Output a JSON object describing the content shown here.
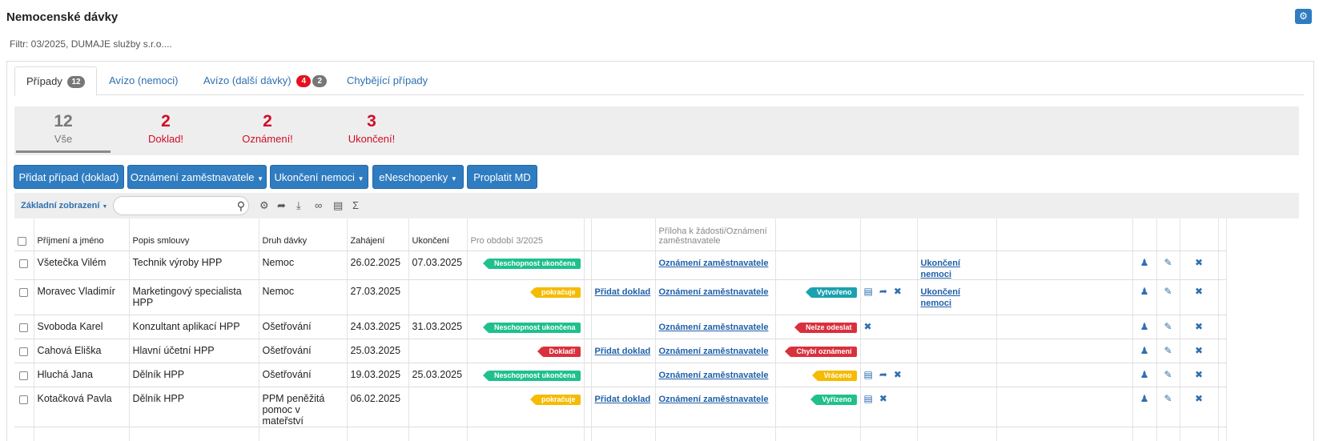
{
  "page": {
    "title": "Nemocenské dávky",
    "filter": "Filtr: 03/2025, DUMAJE služby s.r.o...."
  },
  "header": {
    "settings_icon": "gear-icon"
  },
  "tabs": [
    {
      "label": "Případy",
      "count": "12"
    },
    {
      "label": "Avízo (nemoci)"
    },
    {
      "label": "Avízo (další dávky)",
      "count_red": "4",
      "count": "2"
    },
    {
      "label": "Chybějící případy"
    }
  ],
  "summary": [
    {
      "num": "12",
      "label": "Vše"
    },
    {
      "num": "2",
      "label": "Doklad!"
    },
    {
      "num": "2",
      "label": "Oznámení!"
    },
    {
      "num": "3",
      "label": "Ukončení!"
    }
  ],
  "actions": {
    "add_case": "Přidat případ (doklad)",
    "employer_notice": "Oznámení zaměstnavatele",
    "end_illness": "Ukončení nemoci",
    "eneschopenky": "eNeschopenky",
    "pay_md": "Proplatit MD"
  },
  "toolbar": {
    "view": "Základní zobrazení",
    "search_placeholder": ""
  },
  "columns": {
    "name": "Příjmení a jméno",
    "contract": "Popis smlouvy",
    "type": "Druh dávky",
    "start": "Zahájení",
    "end": "Ukončení",
    "period": "Pro období 3/2025",
    "attachment": "Příloha k žádosti/Oznámení zaměstnavatele"
  },
  "links": {
    "add_doc": "Přidat doklad",
    "employer_notice": "Oznámení zaměstnavatele",
    "end_illness": "Ukončení nemoci"
  },
  "rows": [
    {
      "name": "Všetečka Vilém",
      "contract": "Technik výroby HPP",
      "type": "Nemoc",
      "start": "26.02.2025",
      "end": "07.03.2025",
      "period_badge": "Neschopnost ukončena",
      "status_badge": ""
    },
    {
      "name": "Moravec Vladimír",
      "contract": "Marketingový specialista HPP",
      "type": "Nemoc",
      "start": "27.03.2025",
      "end": "",
      "period_badge": "pokračuje",
      "status_badge": "Vytvořeno"
    },
    {
      "name": "Svoboda Karel",
      "contract": "Konzultant aplikací HPP",
      "type": "Ošetřování",
      "start": "24.03.2025",
      "end": "31.03.2025",
      "period_badge": "Neschopnost ukončena",
      "status_badge": "Nelze odeslat"
    },
    {
      "name": "Cahová Eliška",
      "contract": "Hlavní účetní HPP",
      "type": "Ošetřování",
      "start": "25.03.2025",
      "end": "",
      "period_badge": "Doklad!",
      "status_badge": "Chybí oznámení"
    },
    {
      "name": "Hluchá Jana",
      "contract": "Dělník HPP",
      "type": "Ošetřování",
      "start": "19.03.2025",
      "end": "25.03.2025",
      "period_badge": "Neschopnost ukončena",
      "status_badge": "Vráceno"
    },
    {
      "name": "Kotačková Pavla",
      "contract": "Dělník HPP",
      "type": "PPM peněžitá pomoc v mateřství",
      "start": "06.02.2025",
      "end": "",
      "period_badge": "pokračuje",
      "status_badge": "Vyřízeno"
    }
  ],
  "colors": {
    "primary": "#2f7cc1",
    "alert_red": "#d00c27",
    "green": "#1fc08c",
    "yellow": "#f5bb00",
    "teal": "#1aa2b0"
  }
}
